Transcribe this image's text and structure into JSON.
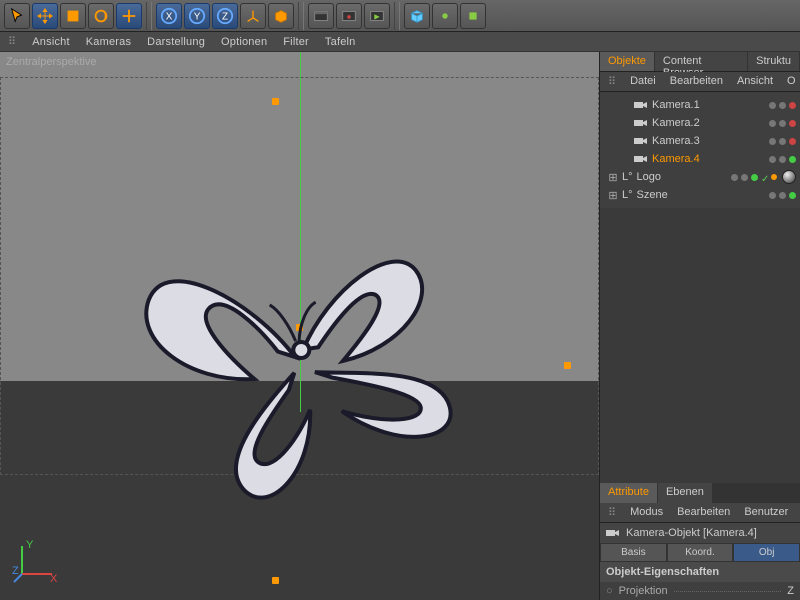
{
  "toolbar_icons": [
    "cursor",
    "move",
    "cube",
    "rotate",
    "crosshair",
    "x-axis",
    "y-axis",
    "z-axis",
    "scale",
    "box",
    "film-a",
    "film-b",
    "film-c",
    "primitive",
    "snap-a",
    "snap-b"
  ],
  "viewport_menu": [
    "⠿",
    "Ansicht",
    "Kameras",
    "Darstellung",
    "Optionen",
    "Filter",
    "Tafeln"
  ],
  "viewport_label": "Zentralperspektive",
  "axis_labels": {
    "x": "X",
    "y": "Y",
    "z": "Z"
  },
  "panel_tabs": [
    "Objekte",
    "Content Browser",
    "Struktu"
  ],
  "panel_menu": [
    "⠿",
    "Datei",
    "Bearbeiten",
    "Ansicht",
    "O"
  ],
  "objects": [
    {
      "name": "Kamera.1",
      "type": "camera",
      "indent": 1,
      "selected": false
    },
    {
      "name": "Kamera.2",
      "type": "camera",
      "indent": 1,
      "selected": false
    },
    {
      "name": "Kamera.3",
      "type": "camera",
      "indent": 1,
      "selected": false
    },
    {
      "name": "Kamera.4",
      "type": "camera",
      "indent": 1,
      "selected": true
    },
    {
      "name": "Logo",
      "type": "null",
      "indent": 0,
      "expand": "+",
      "selected": false,
      "extra": true
    },
    {
      "name": "Szene",
      "type": "null",
      "indent": 0,
      "expand": "+",
      "selected": false
    }
  ],
  "attr_tabs": [
    "Attribute",
    "Ebenen"
  ],
  "attr_menu": [
    "⠿",
    "Modus",
    "Bearbeiten",
    "Benutzer"
  ],
  "attr_title": "Kamera-Objekt [Kamera.4]",
  "attr_sub": [
    "Basis",
    "Koord.",
    "Obj"
  ],
  "attr_section": "Objekt-Eigenschaften",
  "attr_props": [
    {
      "label": "Projektion",
      "val": "Z"
    }
  ],
  "colors": {
    "accent": "#f90",
    "axis_x": "#d44",
    "axis_y": "#4c4",
    "axis_z": "#48d"
  }
}
